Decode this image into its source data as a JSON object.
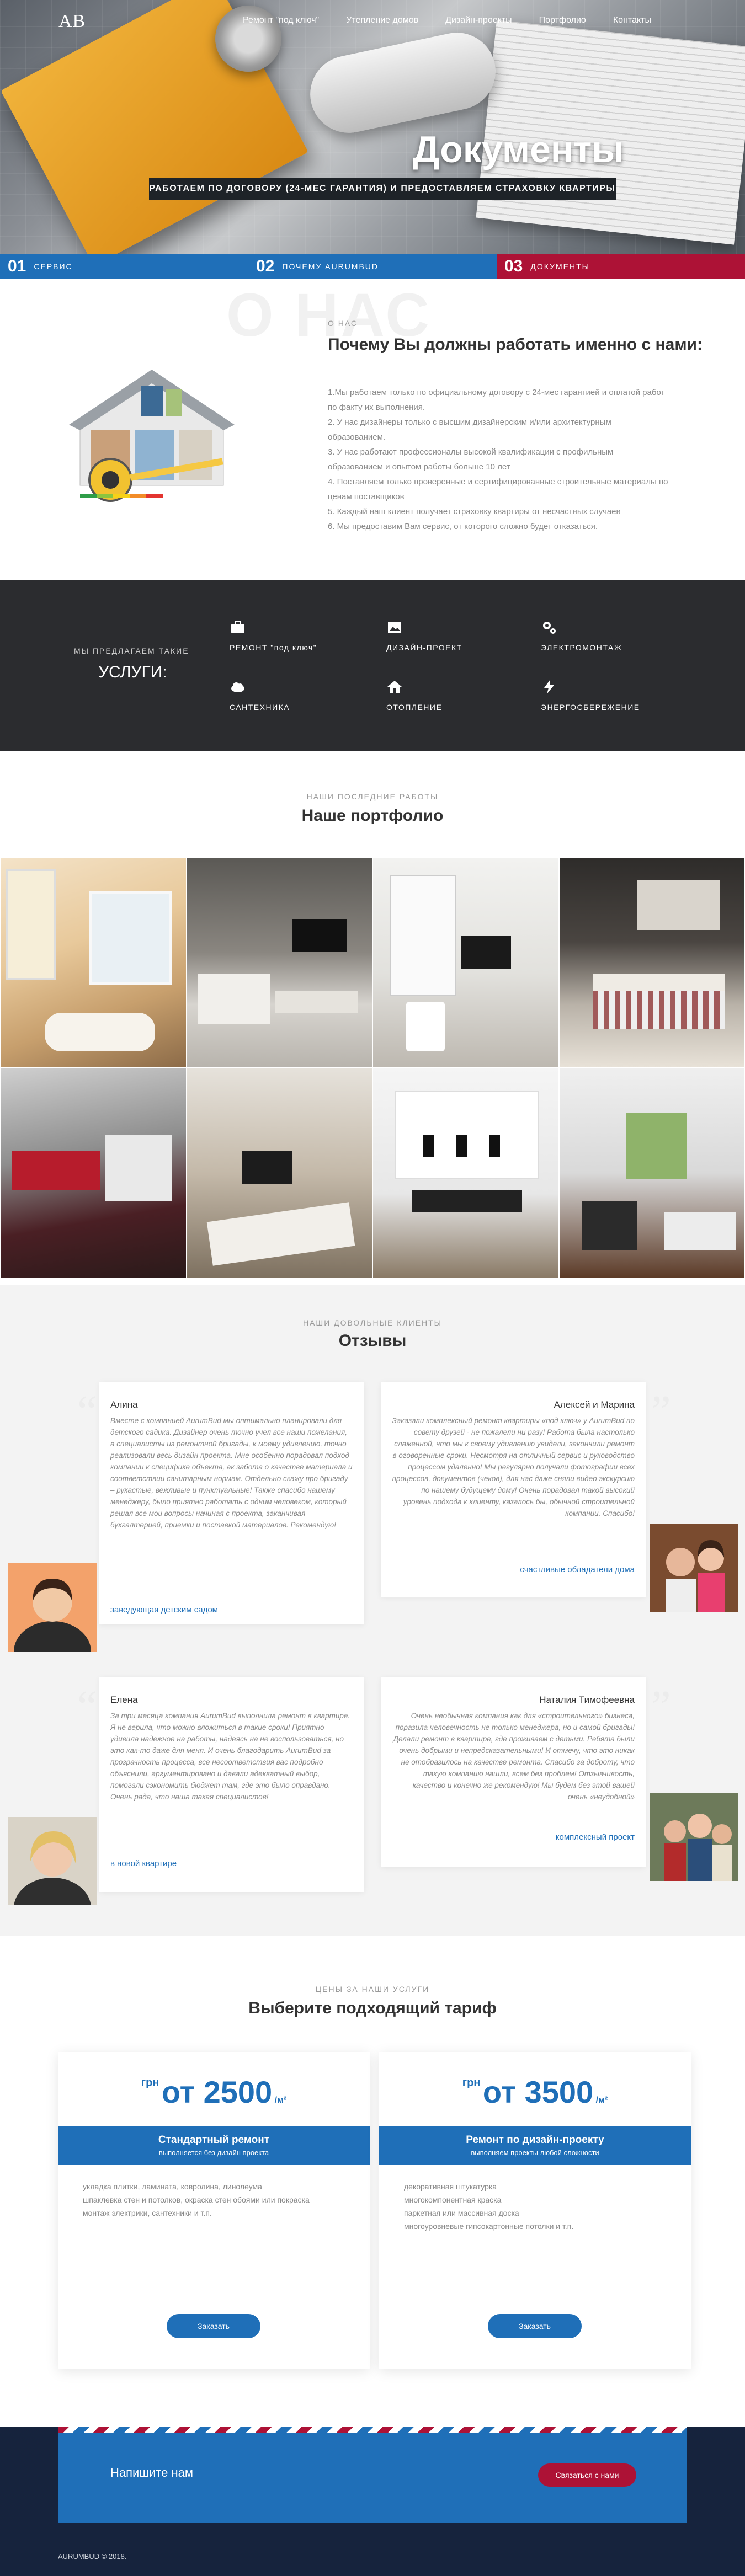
{
  "header": {
    "logo": "AB",
    "nav": [
      "Ремонт \"под ключ\"",
      "Утепление домов",
      "Дизайн-проекты",
      "Портфолио",
      "Контакты"
    ]
  },
  "hero": {
    "title": "Документы",
    "subtitle": "РАБОТАЕМ ПО ДОГОВОРУ (24-МЕС ГАРАНТИЯ) И ПРЕДОСТАВЛЯЕМ СТРАХОВКУ КВАРТИРЫ",
    "steps": [
      {
        "num": "01",
        "label": "СЕРВИС"
      },
      {
        "num": "02",
        "label": "ПОЧЕМУ AURUMBUD"
      },
      {
        "num": "03",
        "label": "ДОКУМЕНТЫ"
      }
    ]
  },
  "about": {
    "ghost": "О НАС",
    "kicker": "О НАС",
    "title": "Почему Вы должны работать именно с нами:",
    "items": [
      "1.Мы работаем только по официальному договору с 24-мес гарантией и оплатой работ",
      "по факту их выполнения.",
      "2. У нас дизайнеры только с высшим дизайнерским и/или архитектурным",
      "образованием.",
      "3. У нас работают профессионалы высокой квалификации с профильным",
      "образованием и опытом работы больше 10 лет",
      "4. Поставляем только проверенные и сертифицированные строительные материалы по",
      "ценам поставщиков",
      "5. Каждый наш клиент получает страховку квартиры от несчастных случаев",
      "6. Мы предоставим Вам сервис, от которого сложно будет отказаться."
    ]
  },
  "services": {
    "kicker": "МЫ ПРЕДЛАГАЕМ ТАКИЕ",
    "title": "УСЛУГИ:",
    "items": [
      {
        "icon": "briefcase-icon",
        "label": "РЕМОНТ \"под ключ\""
      },
      {
        "icon": "image-icon",
        "label": "ДИЗАЙН-ПРОЕКТ"
      },
      {
        "icon": "gears-icon",
        "label": "ЭЛЕКТРОМОНТАЖ"
      },
      {
        "icon": "cloud-icon",
        "label": "САНТЕХНИКА"
      },
      {
        "icon": "house-icon",
        "label": "ОТОПЛЕНИЕ"
      },
      {
        "icon": "lightning-icon",
        "label": "ЭНЕРГОСБЕРЕЖЕНИЕ"
      }
    ]
  },
  "portfolio": {
    "kicker": "НАШИ ПОСЛЕДНИЕ РАБОТЫ",
    "title": "Наше портфолио"
  },
  "reviews": {
    "kicker": "НАШИ ДОВОЛЬНЫЕ КЛИЕНТЫ",
    "title": "Отзывы",
    "items": [
      {
        "name": "Алина",
        "text": "Вместе с компанией AurumBud мы оптимально планировали для детского садика. Дизайнер очень точно учел все наши пожелания, а специалисты из ремонтной бригады, к моему удивлению, точно реализовали весь дизайн проекта. Мне особенно порадовал подход компании к специфике объекта, ак забота о качестве материала и соответствии санитарным нормам. Отдельно скажу про бригаду – рукастые, вежливые и пунктуальные! Также спасибо нашему менеджеру, было приятно работать с одним человеком, который решал все мои вопросы начиная с проекта, заканчивая бухгалтерией, приемки и поставкой материалов. Рекомендую!",
        "link": "заведующая детским садом"
      },
      {
        "name": "Алексей и Марина",
        "text": "Заказали комплексный ремонт квартиры «под ключ» у AurumBud по совету друзей - не пожалели ни разу! Работа была настолько слаженной, что мы к своему удивлению увидели, закончили ремонт в оговоренные сроки. Несмотря на отличный сервис и руководство процессом удаленно! Мы регулярно получали фотографии всех процессов, документов (чеков), для нас даже сняли видео экскурсию по нашему будущему дому! Очень порадовал такой высокий уровень подхода к клиенту, казалось бы, обычной строительной компании. Спасибо!",
        "link": "счастливые обладатели дома"
      },
      {
        "name": "Елена",
        "text": "За три месяца компания AurumBud выполнила ремонт в квартире. Я не верила, что можно вложиться в такие сроки! Приятно удивила надежное на работы, надеясь на не воспользоваться, но это как-то даже для меня. И очень благодарить AurumBud за прозрачность процесса, все несоответствия вас подробно объяснили, аргументировано и давали адекватный выбор, помогали сэкономить бюджет там, где это было оправдано. Очень рада, что наша такая специалистов!",
        "link": "в новой квартире"
      },
      {
        "name": "Наталия Тимофеевна",
        "text": "Очень необычная компания как для «строительного» бизнеса, поразила человечность не только менеджера, но и самой бригады! Делали ремонт в квартире, где проживаем с детьми. Ребята были очень добрыми и непредсказательными! И отмечу, что это никак не отобразилось на качестве ремонта. Спасибо за доброту, что такую компанию нашли, всем без проблем! Отзывчивость, качество и конечно же рекомендую! Мы будем без этой вашей очень «неудобной»",
        "link": "комплексный проект"
      }
    ]
  },
  "pricing": {
    "kicker": "ЦЕНЫ ЗА НАШИ УСЛУГИ",
    "title": "Выберите подходящий тариф",
    "plans": [
      {
        "currency": "грн",
        "price": "от 2500",
        "unit": "/м²",
        "name": "Стандартный ремонт",
        "desc": "выполняется без дизайн проекта",
        "features": [
          "укладка плитки, ламината, ковролина, линолеума",
          "шпаклевка стен и потолков, окраска стен обоями или покраска",
          "монтаж электрики, сантехники и т.п."
        ],
        "button": "Заказать"
      },
      {
        "currency": "грн",
        "price": "от 3500",
        "unit": "/м²",
        "name": "Ремонт по дизайн-проекту",
        "desc": "выполняем проекты любой сложности",
        "features": [
          "декоративная штукатурка",
          "многокомпонентная краска",
          "паркетная или массивная доска",
          "многоуровневые гипсокартонные потолки и т.п."
        ],
        "button": "Заказать"
      }
    ]
  },
  "footer": {
    "cta_text": "Напишите нам",
    "cta_button": "Связаться с нами",
    "copyright": "AURUMBUD © 2018."
  },
  "colors": {
    "accent": "#1f6fb8",
    "red": "#ad1236",
    "dark": "#2b2c2f",
    "navy": "#16233d"
  }
}
